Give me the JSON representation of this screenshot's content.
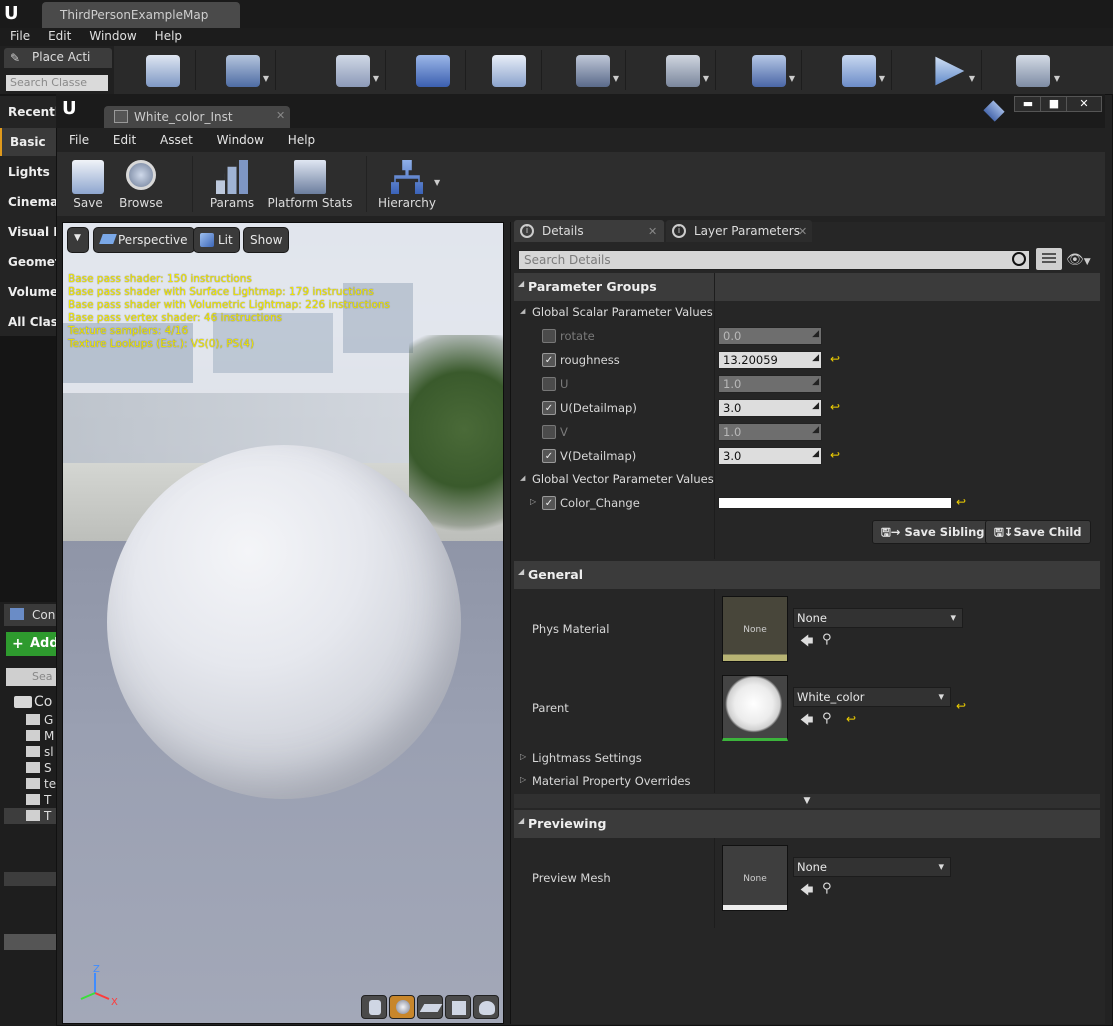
{
  "main": {
    "tab_title": "ThirdPersonExampleMap",
    "menu": [
      "File",
      "Edit",
      "Window",
      "Help"
    ],
    "place_tab": "Place Acti",
    "search_placeholder": "Search Classe",
    "categories": [
      "Recently",
      "Basic",
      "Lights",
      "Cinemat",
      "Visual E",
      "Geomet",
      "Volumes",
      "All Class"
    ],
    "content_tab": "Con",
    "add_button": "Add",
    "content_search": "Sea",
    "content_root": "Co",
    "folders": [
      "G",
      "M",
      "sl",
      "S",
      "te",
      "T",
      "T"
    ]
  },
  "editor": {
    "tab_title": "White_color_Inst",
    "menu": [
      "File",
      "Edit",
      "Asset",
      "Window",
      "Help"
    ],
    "toolbar": {
      "save": "Save",
      "browse": "Browse",
      "params": "Params",
      "platform_stats": "Platform Stats",
      "hierarchy": "Hierarchy"
    },
    "window_buttons": {
      "minimize": "▬",
      "maximize": "■",
      "close": "✕"
    }
  },
  "viewport": {
    "perspective": "Perspective",
    "lit": "Lit",
    "show": "Show",
    "stats": [
      "Base pass shader: 150 instructions",
      "Base pass shader with Surface Lightmap: 179 instructions",
      "Base pass shader with Volumetric Lightmap: 226 instructions",
      "Base pass vertex shader: 46 instructions",
      "Texture samplers: 4/16",
      "Texture Lookups (Est.): VS(0), PS(4)"
    ],
    "axis": {
      "z": "Z",
      "x": "X"
    }
  },
  "details": {
    "tab_details": "Details",
    "tab_layer": "Layer Parameters",
    "search_placeholder": "Search Details",
    "parameter_groups": "Parameter Groups",
    "scalar_group": "Global Scalar Parameter Values",
    "scalars": [
      {
        "name": "rotate",
        "value": "0.0",
        "enabled": false
      },
      {
        "name": "roughness",
        "value": "13.20059",
        "enabled": true
      },
      {
        "name": "U",
        "value": "1.0",
        "enabled": false
      },
      {
        "name": "U(Detailmap)",
        "value": "3.0",
        "enabled": true
      },
      {
        "name": "V",
        "value": "1.0",
        "enabled": false
      },
      {
        "name": "V(Detailmap)",
        "value": "3.0",
        "enabled": true
      }
    ],
    "vector_group": "Global Vector Parameter Values",
    "vector_param": "Color_Change",
    "vector_color": "#ffffff",
    "save_sibling": "Save Sibling",
    "save_child": "Save Child",
    "general": "General",
    "phys_material_label": "Phys Material",
    "phys_material_thumb": "None",
    "phys_material_value": "None",
    "parent_label": "Parent",
    "parent_value": "White_color",
    "lightmass": "Lightmass Settings",
    "overrides": "Material Property Overrides",
    "previewing": "Previewing",
    "preview_mesh_label": "Preview Mesh",
    "preview_mesh_thumb": "None",
    "preview_mesh_value": "None"
  },
  "colors": {
    "accent": "#e09a1c",
    "stats_text": "#f2e900",
    "add_button": "#2e9a2e"
  }
}
